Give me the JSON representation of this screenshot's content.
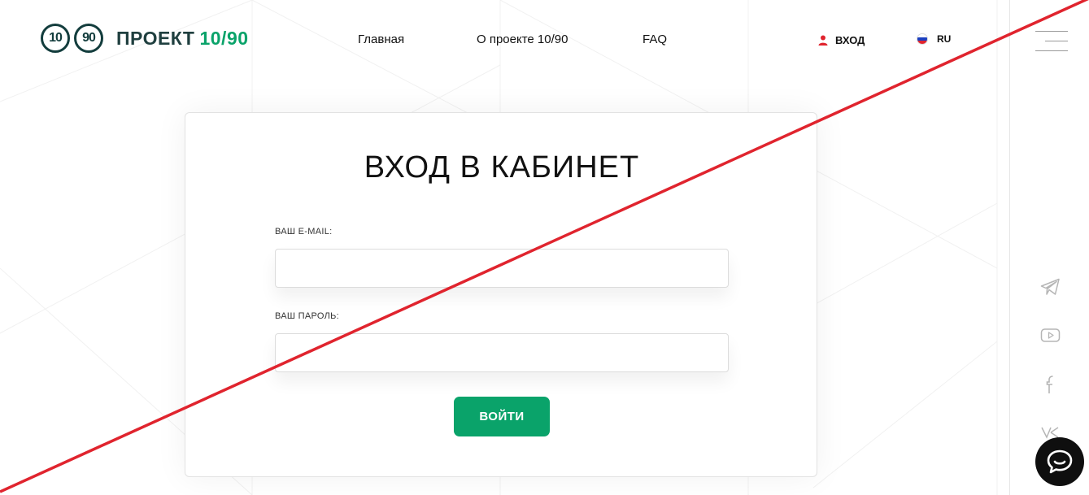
{
  "header": {
    "logo": {
      "mark_left": "10",
      "mark_right": "90",
      "text": "ПРОЕКТ",
      "accent": "10/90"
    },
    "nav": [
      {
        "label": "Главная"
      },
      {
        "label": "О проекте 10/90"
      },
      {
        "label": "FAQ"
      }
    ],
    "login_label": "ВХОД",
    "language": "RU"
  },
  "login_form": {
    "title": "ВХОД В КАБИНЕТ",
    "email": {
      "label": "ВАШ E-MAIL:",
      "value": "",
      "placeholder": ""
    },
    "password": {
      "label": "ВАШ ПАРОЛЬ:",
      "value": "",
      "placeholder": ""
    },
    "submit_label": "ВОЙТИ"
  },
  "social": [
    "telegram-icon",
    "youtube-icon",
    "facebook-icon",
    "vk-icon"
  ],
  "colors": {
    "accent": "#0aa36a",
    "logo_dark": "#133d3d",
    "strike_red": "#e0242e",
    "chat_bg": "#0f0f0f"
  }
}
